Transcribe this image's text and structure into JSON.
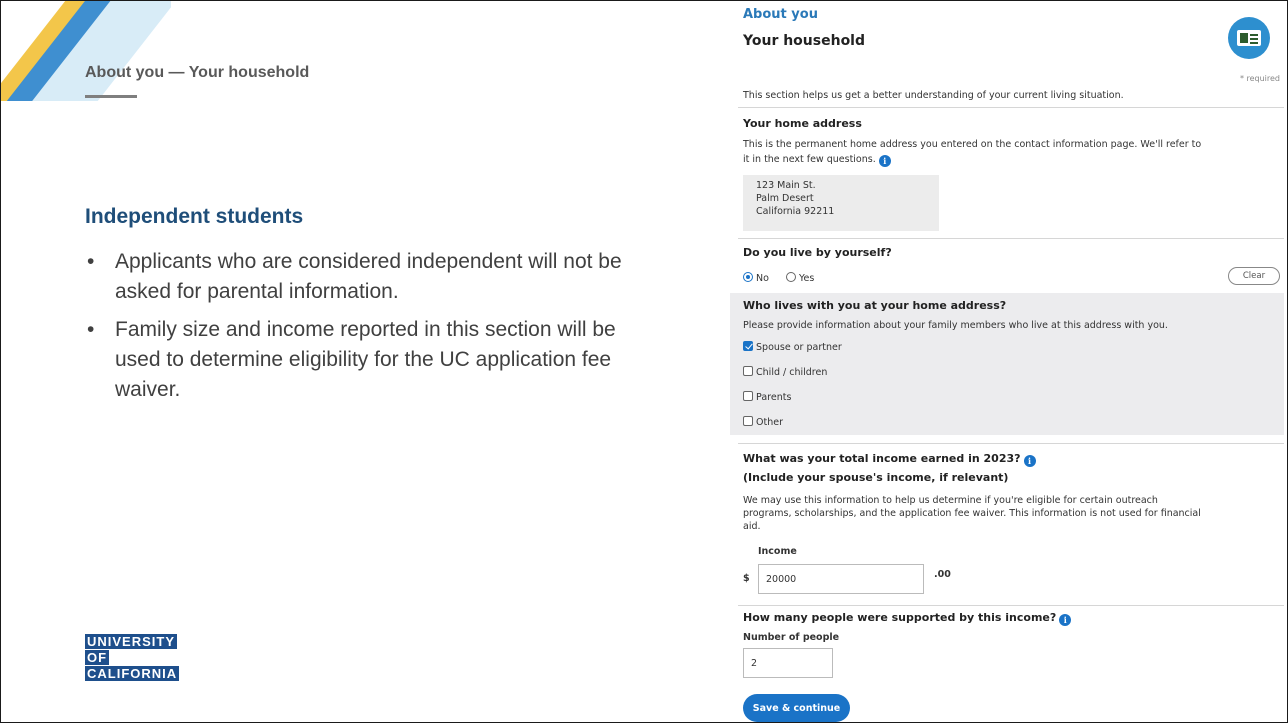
{
  "slide": {
    "title": "About you — Your household",
    "heading": "Independent students",
    "bullets": [
      "Applicants who are considered independent will not be asked for parental information.",
      "Family size and income reported in this section will be used to determine eligibility for the UC application fee waiver."
    ],
    "logo": {
      "line1": "UNIVERSITY",
      "line2": "OF",
      "line3": "CALIFORNIA"
    }
  },
  "form": {
    "section_label": "About you",
    "section_title": "Your household",
    "required_note": "* required",
    "intro": "This section helps us get a better understanding of your current living situation.",
    "home_address": {
      "title": "Your home address",
      "desc_line1": "This is the permanent home address you entered on the contact information page. We'll refer to",
      "desc_line2": "it in the next few questions.",
      "line1": "123 Main St.",
      "line2": "Palm Desert",
      "line3": "California 92211"
    },
    "live_alone": {
      "question": "Do you live by yourself?",
      "options": [
        "No",
        "Yes"
      ],
      "selected": "No",
      "clear_label": "Clear"
    },
    "lives_with": {
      "question": "Who lives with you at your home address?",
      "desc": "Please provide information about your family members who live at this address with you.",
      "options": [
        {
          "label": "Spouse or partner",
          "checked": true
        },
        {
          "label": "Child / children",
          "checked": false
        },
        {
          "label": "Parents",
          "checked": false
        },
        {
          "label": "Other",
          "checked": false
        }
      ]
    },
    "income": {
      "question": "What was your total income earned in 2023?",
      "question2": "(Include your spouse's income, if relevant)",
      "desc_line1": "We may use this information to help us determine if you're eligible for certain outreach",
      "desc_line2": "programs, scholarships, and the application fee waiver. This information is not used for financial",
      "desc_line3": "aid.",
      "label": "Income",
      "currency": "$",
      "value": "20000",
      "cents": ".00"
    },
    "people": {
      "question": "How many people were supported by this income?",
      "label": "Number of people",
      "value": "2"
    },
    "save_label": "Save & continue"
  },
  "colors": {
    "accent": "#1a73c7",
    "heading": "#1f4e79",
    "logo": "#1e4f8c"
  }
}
